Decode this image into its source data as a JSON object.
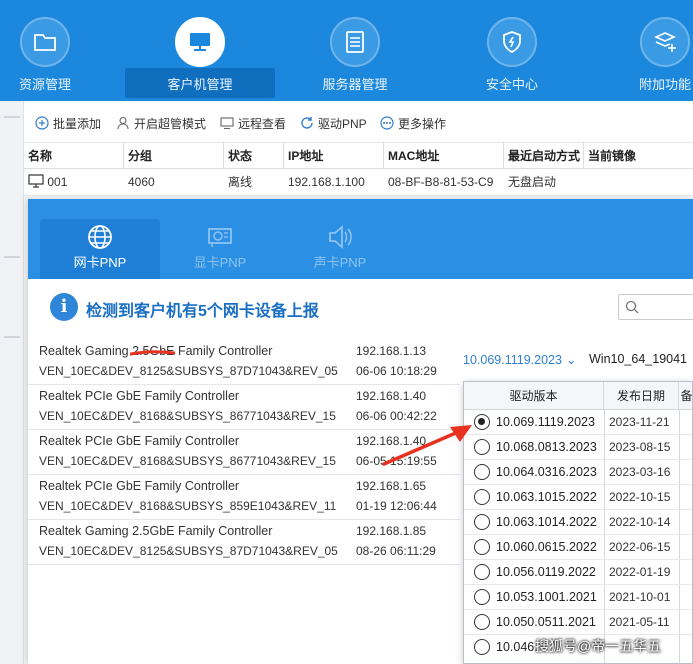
{
  "nav": {
    "items": [
      {
        "label": "资源管理",
        "icon": "folder-icon"
      },
      {
        "label": "客户机管理",
        "icon": "monitor-icon",
        "active": true
      },
      {
        "label": "服务器管理",
        "icon": "server-icon"
      },
      {
        "label": "安全中心",
        "icon": "shield-icon"
      },
      {
        "label": "附加功能",
        "icon": "layers-plus-icon"
      }
    ]
  },
  "toolbar": {
    "batch_add": "批量添加",
    "super_mode": "开启超管模式",
    "remote_view": "远程查看",
    "driver_pnp": "驱动PNP",
    "more": "更多操作"
  },
  "table": {
    "headers": [
      "名称",
      "分组",
      "状态",
      "IP地址",
      "MAC地址",
      "最近启动方式",
      "当前镜像"
    ],
    "row": {
      "name": "001",
      "group": "4060",
      "status": "离线",
      "ip": "192.168.1.100",
      "mac": "08-BF-B8-81-53-C9",
      "boot": "无盘启动",
      "image": ""
    }
  },
  "dialog": {
    "tabs": [
      {
        "label": "网卡PNP",
        "icon": "globe-icon",
        "active": true
      },
      {
        "label": "显卡PNP",
        "icon": "gpu-icon"
      },
      {
        "label": "声卡PNP",
        "icon": "speaker-icon"
      }
    ],
    "info_icon": "i",
    "info": "检测到客户机有5个网卡设备上报",
    "selected_version": "10.069.1119.2023",
    "os": "Win10_64_19041",
    "nics": [
      {
        "name": "Realtek Gaming 2.5GbE Family Controller",
        "id": "VEN_10EC&DEV_8125&SUBSYS_87D71043&REV_05",
        "ip": "192.168.1.13",
        "time": "06-06 10:18:29"
      },
      {
        "name": "Realtek PCIe GbE Family Controller",
        "id": "VEN_10EC&DEV_8168&SUBSYS_86771043&REV_15",
        "ip": "192.168.1.40",
        "time": "06-06 00:42:22"
      },
      {
        "name": "Realtek PCIe GbE Family Controller",
        "id": "VEN_10EC&DEV_8168&SUBSYS_86771043&REV_15",
        "ip": "192.168.1.40",
        "time": "06-05 15:19:55"
      },
      {
        "name": "Realtek PCIe GbE Family Controller",
        "id": "VEN_10EC&DEV_8168&SUBSYS_859E1043&REV_11",
        "ip": "192.168.1.65",
        "time": "01-19 12:06:44"
      },
      {
        "name": "Realtek Gaming 2.5GbE Family Controller",
        "id": "VEN_10EC&DEV_8125&SUBSYS_87D71043&REV_05",
        "ip": "192.168.1.85",
        "time": "08-26 06:11:29"
      }
    ]
  },
  "dropdown": {
    "headers": [
      "驱动版本",
      "发布日期",
      "备"
    ],
    "rows": [
      {
        "version": "10.069.1119.2023",
        "date": "2023-11-21",
        "selected": true
      },
      {
        "version": "10.068.0813.2023",
        "date": "2023-08-15"
      },
      {
        "version": "10.064.0316.2023",
        "date": "2023-03-16"
      },
      {
        "version": "10.063.1015.2022",
        "date": "2022-10-15"
      },
      {
        "version": "10.063.1014.2022",
        "date": "2022-10-14"
      },
      {
        "version": "10.060.0615.2022",
        "date": "2022-06-15"
      },
      {
        "version": "10.056.0119.2022",
        "date": "2022-01-19"
      },
      {
        "version": "10.053.1001.2021",
        "date": "2021-10-01"
      },
      {
        "version": "10.050.0511.2021",
        "date": "2021-05-11"
      },
      {
        "version": "10.046.",
        "date": ""
      }
    ]
  },
  "watermark": "搜狐号@帝一五华五",
  "colors": {
    "brand": "#1c88dd",
    "accent": "#2f7fd0",
    "annotation": "#e8321f"
  }
}
